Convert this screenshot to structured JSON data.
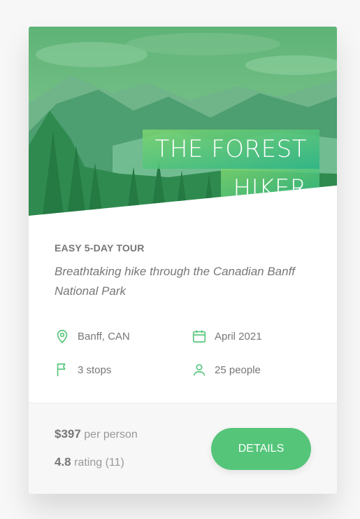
{
  "card": {
    "title_line1": "The Forest",
    "title_line2": "Hiker",
    "subtitle": "Easy 5-day tour",
    "description": "Breathtaking hike through the Canadian Banff National Park",
    "facts": [
      {
        "icon": "map-pin-icon",
        "label": "Banff, CAN"
      },
      {
        "icon": "calendar-icon",
        "label": "April 2021"
      },
      {
        "icon": "flag-icon",
        "label": "3 stops"
      },
      {
        "icon": "user-icon",
        "label": "25 people"
      }
    ],
    "price_value": "$397",
    "price_unit": "per person",
    "rating_value": "4.8",
    "rating_text": "rating (11)",
    "button_label": "Details"
  },
  "colors": {
    "accent": "#55c57a",
    "accent_dark": "#28b485",
    "text": "#777777"
  }
}
